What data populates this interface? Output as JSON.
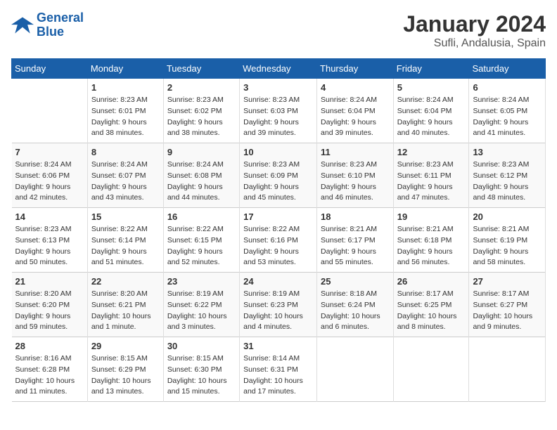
{
  "header": {
    "logo_text_general": "General",
    "logo_text_blue": "Blue",
    "title": "January 2024",
    "subtitle": "Sufli, Andalusia, Spain"
  },
  "calendar": {
    "headers": [
      "Sunday",
      "Monday",
      "Tuesday",
      "Wednesday",
      "Thursday",
      "Friday",
      "Saturday"
    ],
    "weeks": [
      [
        {
          "day": "",
          "sunrise": "",
          "sunset": "",
          "daylight": ""
        },
        {
          "day": "1",
          "sunrise": "Sunrise: 8:23 AM",
          "sunset": "Sunset: 6:01 PM",
          "daylight": "Daylight: 9 hours and 38 minutes."
        },
        {
          "day": "2",
          "sunrise": "Sunrise: 8:23 AM",
          "sunset": "Sunset: 6:02 PM",
          "daylight": "Daylight: 9 hours and 38 minutes."
        },
        {
          "day": "3",
          "sunrise": "Sunrise: 8:23 AM",
          "sunset": "Sunset: 6:03 PM",
          "daylight": "Daylight: 9 hours and 39 minutes."
        },
        {
          "day": "4",
          "sunrise": "Sunrise: 8:24 AM",
          "sunset": "Sunset: 6:04 PM",
          "daylight": "Daylight: 9 hours and 39 minutes."
        },
        {
          "day": "5",
          "sunrise": "Sunrise: 8:24 AM",
          "sunset": "Sunset: 6:04 PM",
          "daylight": "Daylight: 9 hours and 40 minutes."
        },
        {
          "day": "6",
          "sunrise": "Sunrise: 8:24 AM",
          "sunset": "Sunset: 6:05 PM",
          "daylight": "Daylight: 9 hours and 41 minutes."
        }
      ],
      [
        {
          "day": "7",
          "sunrise": "Sunrise: 8:24 AM",
          "sunset": "Sunset: 6:06 PM",
          "daylight": "Daylight: 9 hours and 42 minutes."
        },
        {
          "day": "8",
          "sunrise": "Sunrise: 8:24 AM",
          "sunset": "Sunset: 6:07 PM",
          "daylight": "Daylight: 9 hours and 43 minutes."
        },
        {
          "day": "9",
          "sunrise": "Sunrise: 8:24 AM",
          "sunset": "Sunset: 6:08 PM",
          "daylight": "Daylight: 9 hours and 44 minutes."
        },
        {
          "day": "10",
          "sunrise": "Sunrise: 8:23 AM",
          "sunset": "Sunset: 6:09 PM",
          "daylight": "Daylight: 9 hours and 45 minutes."
        },
        {
          "day": "11",
          "sunrise": "Sunrise: 8:23 AM",
          "sunset": "Sunset: 6:10 PM",
          "daylight": "Daylight: 9 hours and 46 minutes."
        },
        {
          "day": "12",
          "sunrise": "Sunrise: 8:23 AM",
          "sunset": "Sunset: 6:11 PM",
          "daylight": "Daylight: 9 hours and 47 minutes."
        },
        {
          "day": "13",
          "sunrise": "Sunrise: 8:23 AM",
          "sunset": "Sunset: 6:12 PM",
          "daylight": "Daylight: 9 hours and 48 minutes."
        }
      ],
      [
        {
          "day": "14",
          "sunrise": "Sunrise: 8:23 AM",
          "sunset": "Sunset: 6:13 PM",
          "daylight": "Daylight: 9 hours and 50 minutes."
        },
        {
          "day": "15",
          "sunrise": "Sunrise: 8:22 AM",
          "sunset": "Sunset: 6:14 PM",
          "daylight": "Daylight: 9 hours and 51 minutes."
        },
        {
          "day": "16",
          "sunrise": "Sunrise: 8:22 AM",
          "sunset": "Sunset: 6:15 PM",
          "daylight": "Daylight: 9 hours and 52 minutes."
        },
        {
          "day": "17",
          "sunrise": "Sunrise: 8:22 AM",
          "sunset": "Sunset: 6:16 PM",
          "daylight": "Daylight: 9 hours and 53 minutes."
        },
        {
          "day": "18",
          "sunrise": "Sunrise: 8:21 AM",
          "sunset": "Sunset: 6:17 PM",
          "daylight": "Daylight: 9 hours and 55 minutes."
        },
        {
          "day": "19",
          "sunrise": "Sunrise: 8:21 AM",
          "sunset": "Sunset: 6:18 PM",
          "daylight": "Daylight: 9 hours and 56 minutes."
        },
        {
          "day": "20",
          "sunrise": "Sunrise: 8:21 AM",
          "sunset": "Sunset: 6:19 PM",
          "daylight": "Daylight: 9 hours and 58 minutes."
        }
      ],
      [
        {
          "day": "21",
          "sunrise": "Sunrise: 8:20 AM",
          "sunset": "Sunset: 6:20 PM",
          "daylight": "Daylight: 9 hours and 59 minutes."
        },
        {
          "day": "22",
          "sunrise": "Sunrise: 8:20 AM",
          "sunset": "Sunset: 6:21 PM",
          "daylight": "Daylight: 10 hours and 1 minute."
        },
        {
          "day": "23",
          "sunrise": "Sunrise: 8:19 AM",
          "sunset": "Sunset: 6:22 PM",
          "daylight": "Daylight: 10 hours and 3 minutes."
        },
        {
          "day": "24",
          "sunrise": "Sunrise: 8:19 AM",
          "sunset": "Sunset: 6:23 PM",
          "daylight": "Daylight: 10 hours and 4 minutes."
        },
        {
          "day": "25",
          "sunrise": "Sunrise: 8:18 AM",
          "sunset": "Sunset: 6:24 PM",
          "daylight": "Daylight: 10 hours and 6 minutes."
        },
        {
          "day": "26",
          "sunrise": "Sunrise: 8:17 AM",
          "sunset": "Sunset: 6:25 PM",
          "daylight": "Daylight: 10 hours and 8 minutes."
        },
        {
          "day": "27",
          "sunrise": "Sunrise: 8:17 AM",
          "sunset": "Sunset: 6:27 PM",
          "daylight": "Daylight: 10 hours and 9 minutes."
        }
      ],
      [
        {
          "day": "28",
          "sunrise": "Sunrise: 8:16 AM",
          "sunset": "Sunset: 6:28 PM",
          "daylight": "Daylight: 10 hours and 11 minutes."
        },
        {
          "day": "29",
          "sunrise": "Sunrise: 8:15 AM",
          "sunset": "Sunset: 6:29 PM",
          "daylight": "Daylight: 10 hours and 13 minutes."
        },
        {
          "day": "30",
          "sunrise": "Sunrise: 8:15 AM",
          "sunset": "Sunset: 6:30 PM",
          "daylight": "Daylight: 10 hours and 15 minutes."
        },
        {
          "day": "31",
          "sunrise": "Sunrise: 8:14 AM",
          "sunset": "Sunset: 6:31 PM",
          "daylight": "Daylight: 10 hours and 17 minutes."
        },
        {
          "day": "",
          "sunrise": "",
          "sunset": "",
          "daylight": ""
        },
        {
          "day": "",
          "sunrise": "",
          "sunset": "",
          "daylight": ""
        },
        {
          "day": "",
          "sunrise": "",
          "sunset": "",
          "daylight": ""
        }
      ]
    ]
  }
}
